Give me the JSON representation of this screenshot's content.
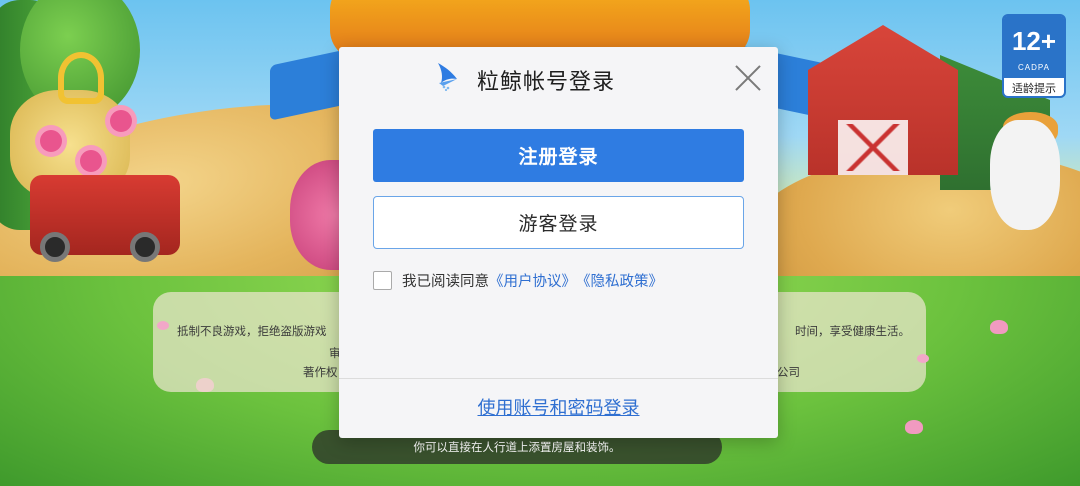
{
  "dialog": {
    "title": "粒鲸帐号登录",
    "register_login_label": "注册登录",
    "guest_login_label": "游客登录",
    "agreement": {
      "prefix": "我已阅读同意",
      "user_agreement": "《用户协议》",
      "privacy_policy": "《隐私政策》",
      "checked": false
    },
    "account_password_login_label": "使用账号和密码登录"
  },
  "notice": {
    "line1_left": "抵制不良游戏，拒绝盗版游戏",
    "line1_right": "时间，享受健康生活。",
    "line2_left": "审",
    "line3_left": "著作权",
    "line3_right": "公司"
  },
  "tip": {
    "text": "你可以直接在人行道上添置房屋和装饰。"
  },
  "age_rating": {
    "age": "12+",
    "org": "CADPA",
    "label": "适龄提示"
  },
  "colors": {
    "primary_button": "#2f7ce2",
    "link": "#2f6fd1",
    "dialog_bg": "#f5f5f7",
    "badge_blue": "#2a73c8"
  }
}
